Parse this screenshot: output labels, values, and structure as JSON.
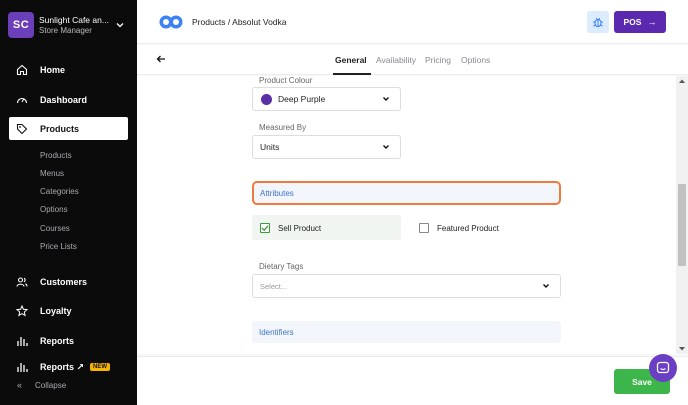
{
  "org": {
    "initials": "SC",
    "name": "Sunlight Cafe an...",
    "role": "Store Manager"
  },
  "sidebar": {
    "items": [
      {
        "label": "Home",
        "icon": "home-icon"
      },
      {
        "label": "Dashboard",
        "icon": "gauge-icon"
      },
      {
        "label": "Products",
        "icon": "tag-icon",
        "active": true
      },
      {
        "label": "Customers",
        "icon": "users-icon"
      },
      {
        "label": "Loyalty",
        "icon": "star-icon"
      },
      {
        "label": "Reports",
        "icon": "bar-chart-icon"
      },
      {
        "label": "Reports ↗",
        "icon": "bar-chart-icon",
        "badge": "NEW"
      }
    ],
    "sub_items": [
      "Products",
      "Menus",
      "Categories",
      "Options",
      "Courses",
      "Price Lists"
    ],
    "collapse_label": "Collapse"
  },
  "header": {
    "breadcrumb": "Products / Absolut Vodka",
    "pos_label": "POS"
  },
  "tabs": [
    {
      "label": "General",
      "active": true
    },
    {
      "label": "Availability"
    },
    {
      "label": "Pricing"
    },
    {
      "label": "Options"
    }
  ],
  "form": {
    "product_colour_label": "Product Colour",
    "product_colour_value": "Deep Purple",
    "measured_by_label": "Measured By",
    "measured_by_value": "Units",
    "attributes_heading": "Attributes",
    "sell_product_label": "Sell Product",
    "sell_product_checked": true,
    "featured_product_label": "Featured Product",
    "featured_product_checked": false,
    "dietary_tags_label": "Dietary Tags",
    "dietary_tags_placeholder": "Select...",
    "identifiers_heading": "Identifiers"
  },
  "footer": {
    "save_label": "Save"
  },
  "colors": {
    "brand_purple": "#5b28b0",
    "swatch_deep_purple": "#5b2fa6",
    "save_green": "#3cb54a",
    "focus_orange": "#ee7a3d",
    "link_blue": "#3d73c9"
  }
}
